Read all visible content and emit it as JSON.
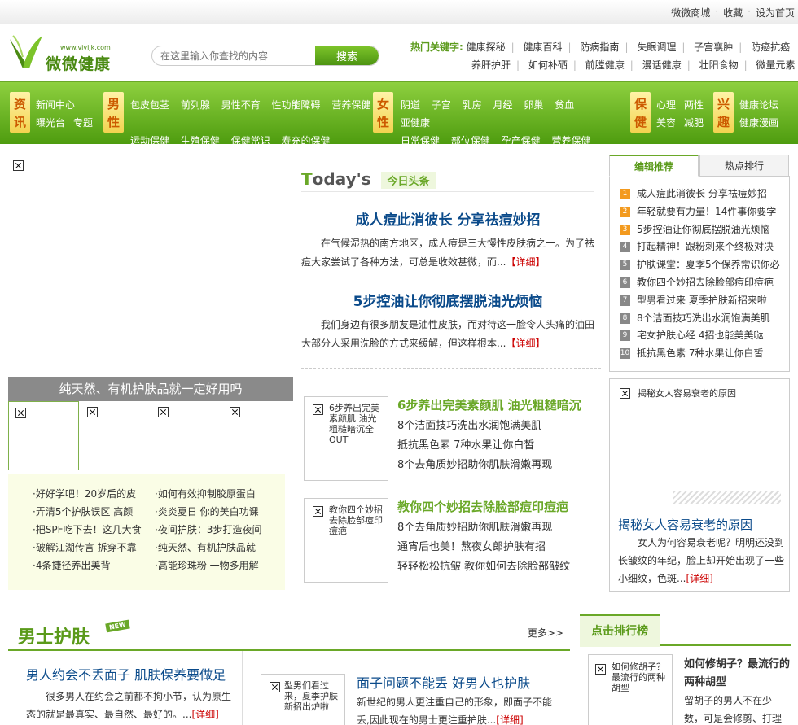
{
  "top_links": [
    "微微商城",
    "收藏",
    "设为首页"
  ],
  "logo": {
    "url": "www.vivijk.com",
    "name": "微微健康"
  },
  "search": {
    "placeholder": "在这里输入你查找的内容",
    "button": "搜索"
  },
  "hotkeys": {
    "label": "热门关键字:",
    "row1": [
      "健康探秘",
      "健康百科",
      "防病指南",
      "失眠调理",
      "子宫襄肿",
      "防癌抗癌"
    ],
    "row2": [
      "养肝护肝",
      "如何补硒",
      "前膛健康",
      "漫话健康",
      "壮阳食物",
      "微量元素"
    ]
  },
  "nav": {
    "zixun": {
      "cat": "资讯",
      "links_r1": [
        "新闻中心"
      ],
      "links_r2": [
        "曝光台",
        "专题"
      ]
    },
    "nanxing": {
      "cat": "男性",
      "links_r1": [
        "包皮包茎",
        "前列腺",
        "男性不育",
        "性功能障碍",
        "营养保健"
      ],
      "links_r3": [
        "运动保健",
        "生殖保健",
        "保健常识",
        "寿充的保健"
      ]
    },
    "nvxing": {
      "cat": "女性",
      "links_r1": [
        "阴道",
        "子宫",
        "乳房",
        "月经",
        "卵巢",
        "贫血"
      ],
      "links_r2": [
        "亚健康"
      ],
      "links_r3": [
        "日常保健",
        "部位保健",
        "孕产保健",
        "营养保健"
      ]
    },
    "baojian": {
      "cat": "保健",
      "links_r1": [
        "心理",
        "两性"
      ],
      "links_r2": [
        "美容",
        "减肥"
      ]
    },
    "xingqu": {
      "cat": "兴趣",
      "links_r1": [
        "健康论坛"
      ],
      "links_r2": [
        "健康漫画"
      ]
    }
  },
  "natural": {
    "heading": "纯天然、有机护肤品就一定好用吗",
    "col1": [
      "·好好学吧！20岁后的皮",
      "·弄清5个护肤误区 高颜",
      "·把SPF吃下去！这几大食",
      "·破解江湖传言 拆穿不靠",
      "·4条捷径养出美背"
    ],
    "col2": [
      "·如何有效抑制胶原蛋白",
      "·炎炎夏日 你的美白功课",
      "·夜间护肤：3步打造夜间",
      "·纯天然、有机护肤品就",
      "·高能珍珠粉 一物多用解"
    ]
  },
  "today": {
    "brand_T": "T",
    "brand_rest": "oday's",
    "tag": "今日头条",
    "items": [
      {
        "title": "成人痘此消彼长 分享祛痘妙招",
        "summary": "在气候湿热的南方地区，成人痘是三大慢性皮肤病之一。为了祛痘大家尝试了各种方法，可总是收效甚微，而...",
        "more": "【详细】"
      },
      {
        "title": "5步控油让你彻底摆脱油光烦恼",
        "summary": "我们身边有很多朋友是油性皮肤，而对待这一脸令人头痛的油田大部分人采用洗脸的方式来缓解，但这样根本...",
        "more": "【详细】"
      }
    ]
  },
  "tabs": {
    "active": "编辑推荐",
    "inactive": "热点排行"
  },
  "ranking": [
    {
      "n": "1",
      "text": "成人痘此消彼长 分享祛痘妙招",
      "color": "#f39a1e"
    },
    {
      "n": "2",
      "text": "年轻就要有力量！14件事你要学",
      "color": "#f39a1e"
    },
    {
      "n": "3",
      "text": "5步控油让你彻底摆脱油光烦恼",
      "color": "#f39a1e"
    },
    {
      "n": "4",
      "text": "打起精神！跟粉刺来个终极对决",
      "color": "#888888"
    },
    {
      "n": "5",
      "text": "护肤课堂：夏季5个保养常识你必",
      "color": "#888888"
    },
    {
      "n": "6",
      "text": "教你四个妙招去除脸部痘印痘疤",
      "color": "#888888"
    },
    {
      "n": "7",
      "text": "型男看过来 夏季护肤新招来啦",
      "color": "#888888"
    },
    {
      "n": "8",
      "text": "8个洁面技巧洗出水润饱满美肌",
      "color": "#888888"
    },
    {
      "n": "9",
      "text": "宅女护肤心经 4招也能美美哒",
      "color": "#888888"
    },
    {
      "n": "10",
      "text": "抵抗黑色素 7种水果让你白皙",
      "color": "#888888"
    }
  ],
  "right_box": {
    "img_alt": "揭秘女人容易衰老的原因",
    "title": "揭秘女人容易衰老的原因",
    "summary": "女人为何容易衰老呢？明明还没到长皱纹的年纪，脸上却开始出现了一些小细纹，色斑...",
    "more": "[详细]"
  },
  "articles": [
    {
      "img_alt": "6步养出完美素颜肌 油光粗糙暗沉全OUT",
      "title": "6步养出完美素颜肌 油光粗糙暗沉",
      "lines": [
        "8个洁面技巧洗出水润饱满美肌",
        "抵抗黑色素  7种水果让你白皙",
        "8个去角质妙招助你肌肤滑嫩再现"
      ]
    },
    {
      "img_alt": "教你四个妙招去除脸部痘印痘疤",
      "title": "教你四个妙招去除脸部痘印痘疤",
      "lines": [
        "8个去角质妙招助你肌肤滑嫩再现",
        "通宵后也美！熬夜女郎护肤有招",
        "轻轻松松抗皱  教你如何去除脸部皱纹"
      ]
    }
  ],
  "mens": {
    "title": "男士护肤",
    "new": "NEW",
    "more": "更多>>",
    "left_title": "男人约会不丢面子 肌肤保养要做足",
    "left_summary": "很多男人在约会之前都不拘小节，认为原生态的就是最真实、最自然、最好的。...",
    "left_more": "[详细]",
    "img_alt": "型男们看过来，夏季护肤新招出炉啦",
    "mid_title": "面子问题不能丢 好男人也护肤",
    "mid_summary": "新世纪的男人更注重自己的形象，即面子不能丢,因此现在的男士更注重护肤...",
    "mid_more": "[详细]"
  },
  "click_rank": {
    "title": "点击排行榜",
    "img_alt": "如何修胡子？最流行的两种胡型",
    "headline": "如何修胡子？最流行的两种胡型",
    "summary": "留胡子的男人不在少数，可是会修剪、打理"
  }
}
